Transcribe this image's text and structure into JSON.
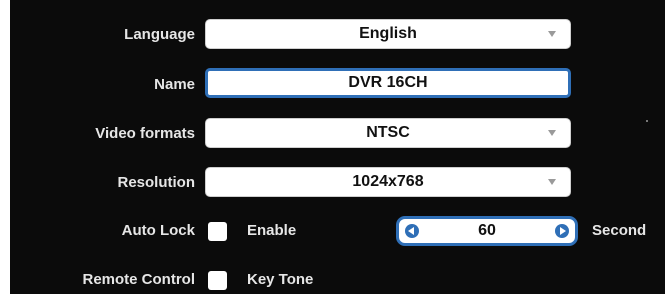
{
  "settings": {
    "language": {
      "label": "Language",
      "value": "English"
    },
    "name": {
      "label": "Name",
      "value": "DVR 16CH"
    },
    "video_formats": {
      "label": "Video formats",
      "value": "NTSC"
    },
    "resolution": {
      "label": "Resolution",
      "value": "1024x768"
    },
    "auto_lock": {
      "label": "Auto Lock",
      "checkbox_label": "Enable",
      "checked": false,
      "spinner_value": "60",
      "unit": "Second"
    },
    "remote_control": {
      "label": "Remote Control",
      "checkbox_label": "Key Tone",
      "checked": false
    }
  },
  "colors": {
    "panel_bg": "#0b0b0b",
    "label_text": "#e6e6e6",
    "focus_border": "#2f6fb7",
    "field_bg": "#ffffff"
  },
  "icons": {
    "dropdown": "chevron-down-icon",
    "decrement": "arrow-left-icon",
    "increment": "arrow-right-icon"
  }
}
